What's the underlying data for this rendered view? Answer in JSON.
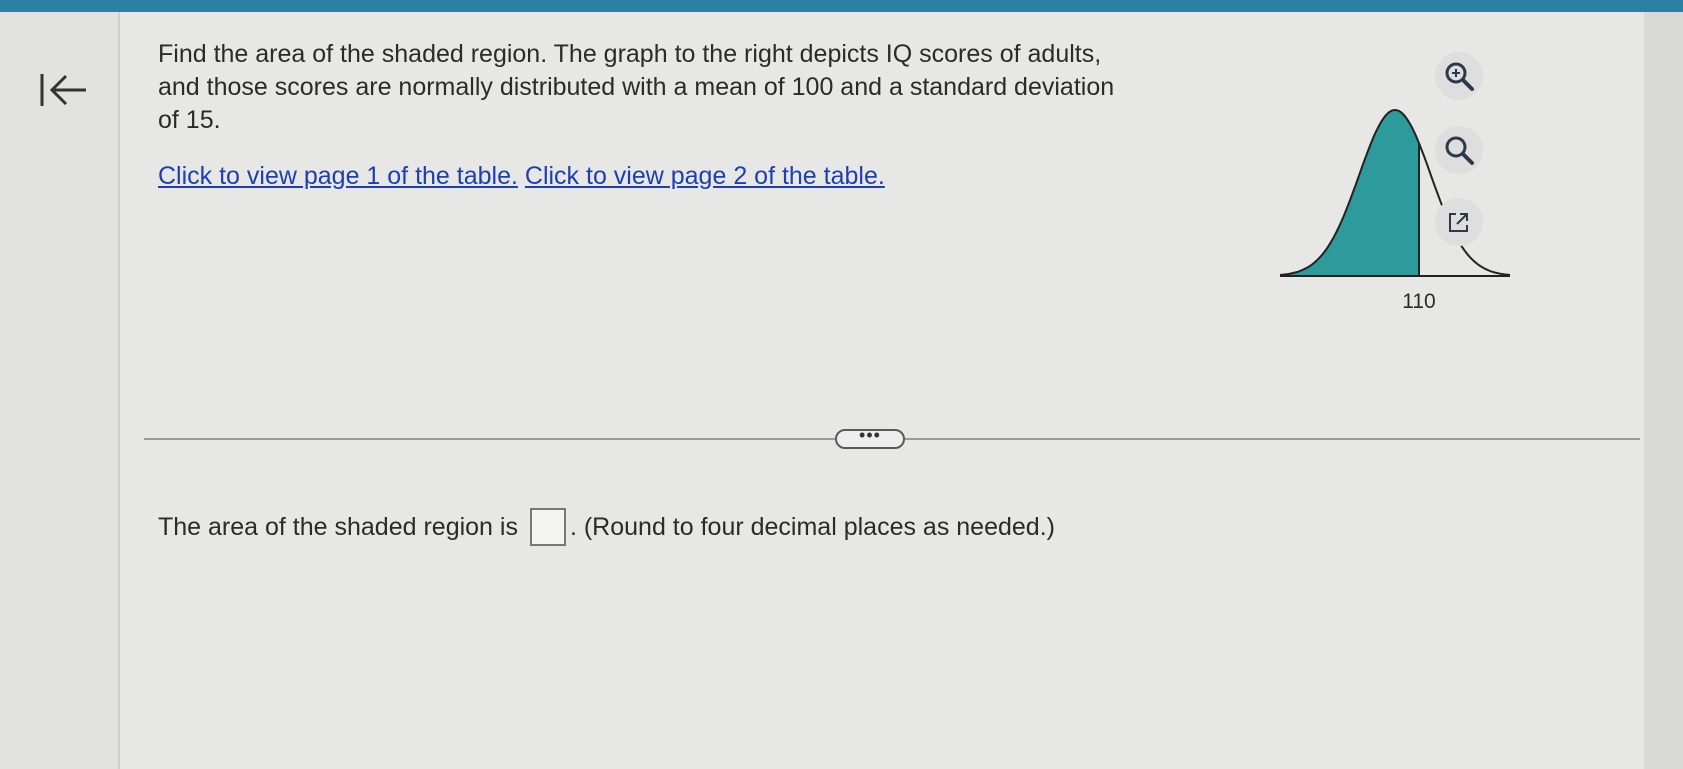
{
  "question": {
    "text": "Find the area of the shaded region. The graph to the right depicts IQ scores of adults, and those scores are normally distributed with a mean of 100 and a standard deviation of 15.",
    "link_page1": "Click to view page 1 of the table.",
    "link_page2": "Click to view page 2 of the table."
  },
  "graph": {
    "x_marker_label": "110",
    "shaded_color": "#2d9a9b",
    "mean": 100,
    "sd": 15,
    "shaded_upper_bound": 110
  },
  "divider": {
    "more_label": "•••"
  },
  "answer": {
    "prefix": "The area of the shaded region is",
    "suffix": ". (Round to four decimal places as needed.)",
    "value": ""
  },
  "tools": {
    "zoom_in_icon": "zoom-in-icon",
    "zoom_out_icon": "zoom-out-icon",
    "popout_icon": "external-link-icon"
  }
}
